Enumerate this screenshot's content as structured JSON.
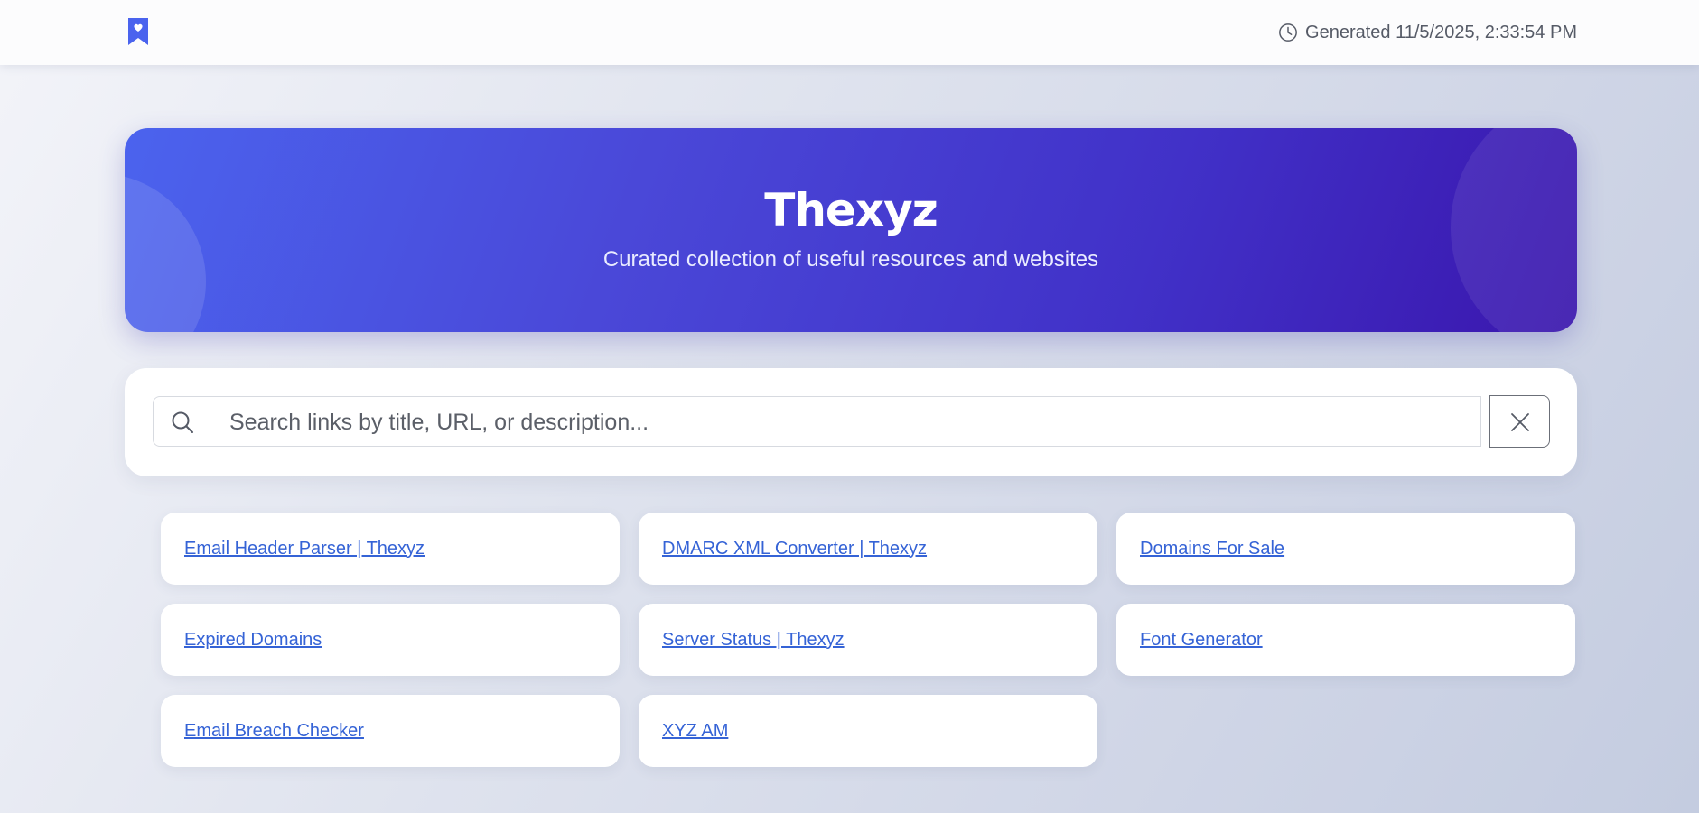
{
  "header": {
    "logo_icon": "bookmark-heart-icon",
    "clock_icon": "clock-icon",
    "generated_text": "Generated 11/5/2025, 2:33:54 PM"
  },
  "hero": {
    "title": "Thexyz",
    "subtitle": "Curated collection of useful resources and websites"
  },
  "search": {
    "icon": "search-icon",
    "placeholder": "Search links by title, URL, or description...",
    "value": "",
    "clear_icon": "close-icon"
  },
  "links": [
    {
      "title": "Email Header Parser | Thexyz"
    },
    {
      "title": "DMARC XML Converter | Thexyz"
    },
    {
      "title": "Domains For Sale"
    },
    {
      "title": "Expired Domains"
    },
    {
      "title": "Server Status | Thexyz"
    },
    {
      "title": "Font Generator"
    },
    {
      "title": "Email Breach Checker"
    },
    {
      "title": "XYZ AM"
    }
  ],
  "colors": {
    "accent": "#4a63ee",
    "hero_end": "#3a16ad",
    "link": "#3563d6"
  }
}
